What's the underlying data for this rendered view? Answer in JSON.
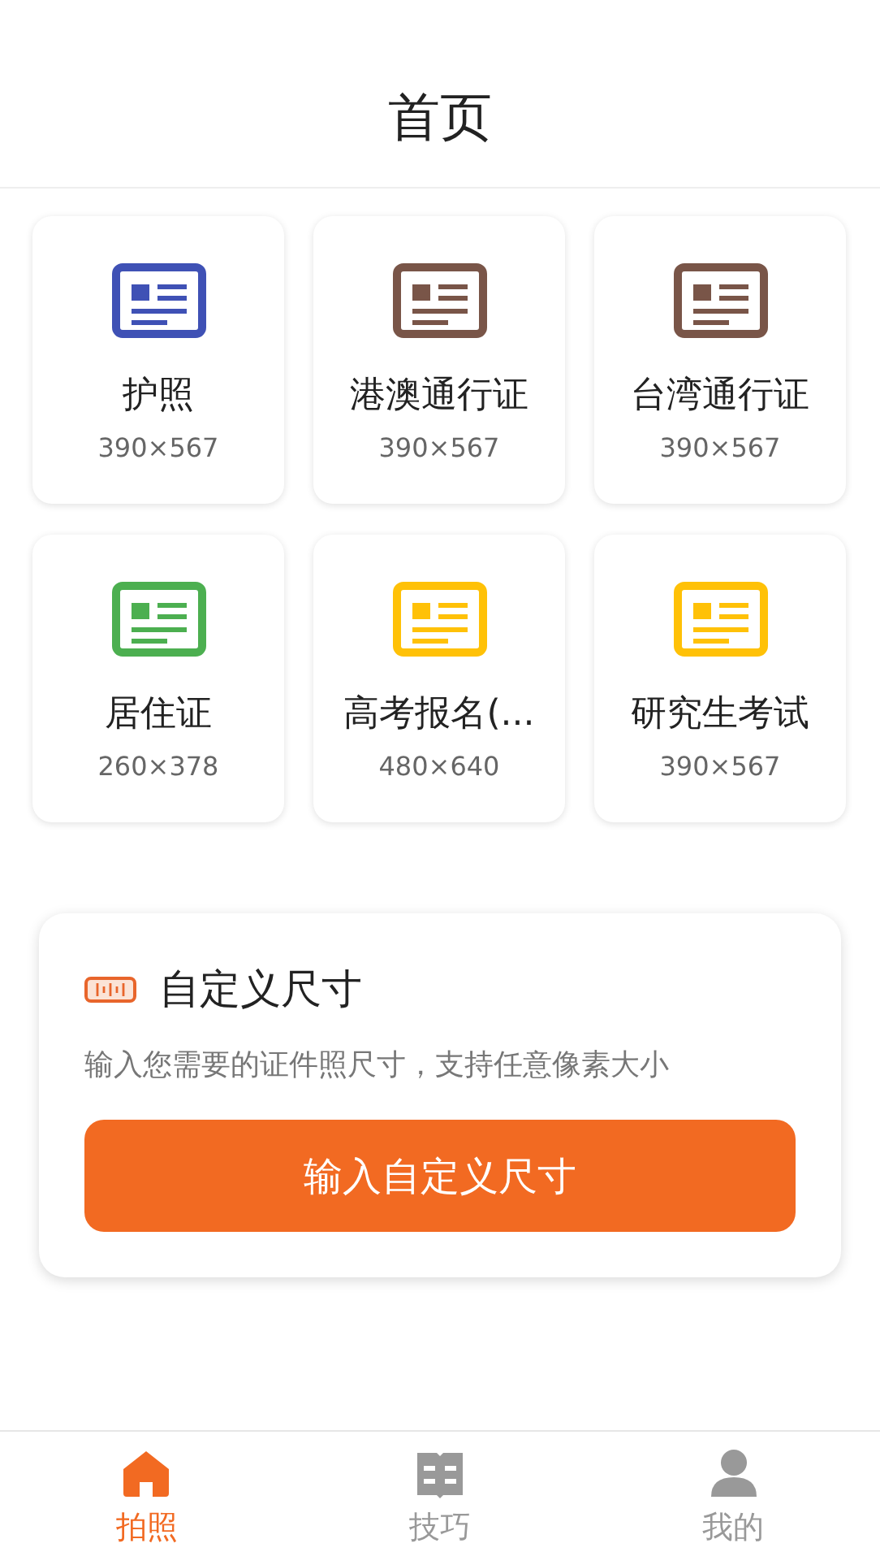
{
  "header": {
    "title": "首页"
  },
  "documents": [
    {
      "name": "护照",
      "size": "390×567",
      "color": "#3f51b5"
    },
    {
      "name": "港澳通行证",
      "size": "390×567",
      "color": "#795548"
    },
    {
      "name": "台湾通行证",
      "size": "390×567",
      "color": "#795548"
    },
    {
      "name": "居住证",
      "size": "260×378",
      "color": "#4caf50"
    },
    {
      "name": "高考报名(...",
      "size": "480×640",
      "color": "#ffc107"
    },
    {
      "name": "研究生考试",
      "size": "390×567",
      "color": "#ffc107"
    }
  ],
  "custom_size": {
    "title": "自定义尺寸",
    "description": "输入您需要的证件照尺寸，支持任意像素大小",
    "button": "输入自定义尺寸"
  },
  "bottom_nav": [
    {
      "label": "拍照",
      "kind": "home",
      "selected": true
    },
    {
      "label": "技巧",
      "kind": "book",
      "selected": false
    },
    {
      "label": "我的",
      "kind": "person",
      "selected": false
    }
  ]
}
